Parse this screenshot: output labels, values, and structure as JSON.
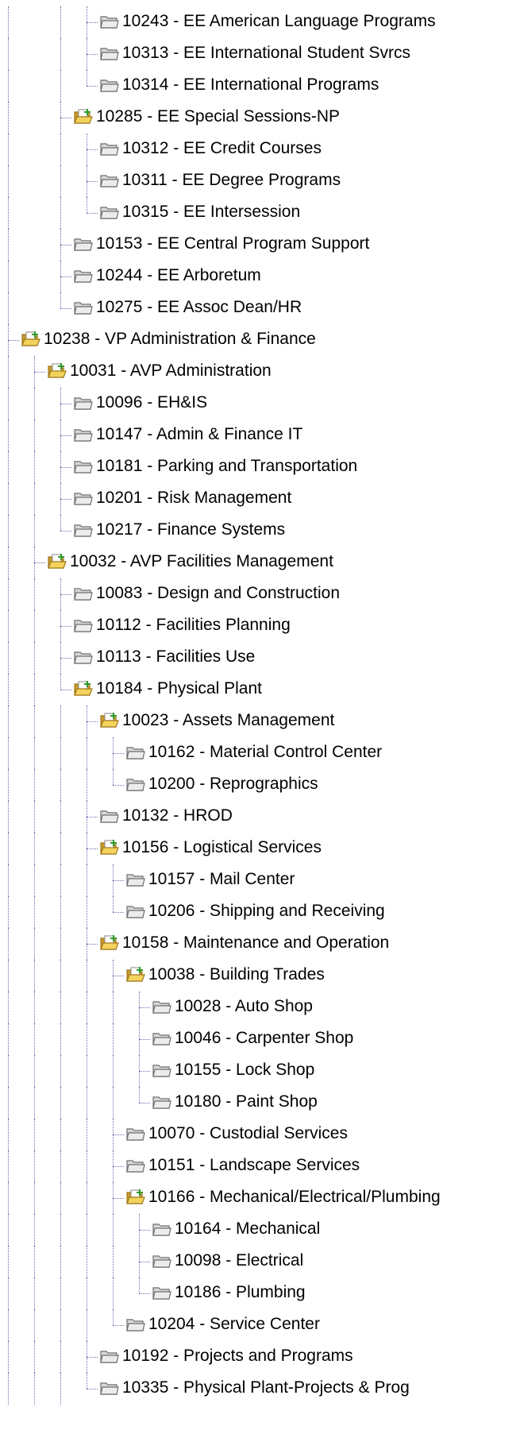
{
  "tree": [
    {
      "level": 3,
      "label": "10243 - EE American Language Programs",
      "icon": "folder-closed-icon",
      "last": false,
      "top_cont": true
    },
    {
      "level": 3,
      "label": "10313 - EE International Student Svrcs",
      "icon": "folder-closed-icon",
      "last": false
    },
    {
      "level": 3,
      "label": "10314 - EE International Programs",
      "icon": "folder-closed-icon",
      "last": true
    },
    {
      "level": 2,
      "label": "10285 - EE Special Sessions-NP",
      "icon": "folder-open-icon",
      "last": false
    },
    {
      "level": 3,
      "label": "10312 - EE Credit Courses",
      "icon": "folder-closed-icon",
      "last": false
    },
    {
      "level": 3,
      "label": "10311 - EE Degree Programs",
      "icon": "folder-closed-icon",
      "last": false
    },
    {
      "level": 3,
      "label": "10315 - EE Intersession",
      "icon": "folder-closed-icon",
      "last": true
    },
    {
      "level": 2,
      "label": "10153 - EE Central Program Support",
      "icon": "folder-closed-icon",
      "last": false
    },
    {
      "level": 2,
      "label": "10244 - EE Arboretum",
      "icon": "folder-closed-icon",
      "last": false
    },
    {
      "level": 2,
      "label": "10275 - EE Assoc Dean/HR",
      "icon": "folder-closed-icon",
      "last": true
    },
    {
      "level": 0,
      "label": "10238 - VP Administration & Finance",
      "icon": "folder-open-icon",
      "last": false
    },
    {
      "level": 1,
      "label": "10031 - AVP Administration",
      "icon": "folder-open-icon",
      "last": false
    },
    {
      "level": 2,
      "label": "10096 - EH&IS",
      "icon": "folder-closed-icon",
      "last": false
    },
    {
      "level": 2,
      "label": "10147 - Admin & Finance IT",
      "icon": "folder-closed-icon",
      "last": false
    },
    {
      "level": 2,
      "label": "10181 - Parking and Transportation",
      "icon": "folder-closed-icon",
      "last": false
    },
    {
      "level": 2,
      "label": "10201 - Risk Management",
      "icon": "folder-closed-icon",
      "last": false
    },
    {
      "level": 2,
      "label": "10217 - Finance Systems",
      "icon": "folder-closed-icon",
      "last": true
    },
    {
      "level": 1,
      "label": "10032 - AVP Facilities Management",
      "icon": "folder-open-icon",
      "last": false
    },
    {
      "level": 2,
      "label": "10083 - Design and Construction",
      "icon": "folder-closed-icon",
      "last": false
    },
    {
      "level": 2,
      "label": "10112 - Facilities Planning",
      "icon": "folder-closed-icon",
      "last": false
    },
    {
      "level": 2,
      "label": "10113 - Facilities Use",
      "icon": "folder-closed-icon",
      "last": false
    },
    {
      "level": 2,
      "label": "10184 - Physical Plant",
      "icon": "folder-open-icon",
      "last": true
    },
    {
      "level": 3,
      "label": "10023 - Assets Management",
      "icon": "folder-open-icon",
      "last": false
    },
    {
      "level": 4,
      "label": "10162 - Material Control Center",
      "icon": "folder-closed-icon",
      "last": false
    },
    {
      "level": 4,
      "label": "10200 - Reprographics",
      "icon": "folder-closed-icon",
      "last": true
    },
    {
      "level": 3,
      "label": "10132 - HROD",
      "icon": "folder-closed-icon",
      "last": false
    },
    {
      "level": 3,
      "label": "10156 - Logistical Services",
      "icon": "folder-open-icon",
      "last": false
    },
    {
      "level": 4,
      "label": "10157 - Mail Center",
      "icon": "folder-closed-icon",
      "last": false
    },
    {
      "level": 4,
      "label": "10206 - Shipping and Receiving",
      "icon": "folder-closed-icon",
      "last": true
    },
    {
      "level": 3,
      "label": "10158 - Maintenance and Operation",
      "icon": "folder-open-icon",
      "last": false
    },
    {
      "level": 4,
      "label": "10038 - Building Trades",
      "icon": "folder-open-icon",
      "last": false
    },
    {
      "level": 5,
      "label": "10028 - Auto Shop",
      "icon": "folder-closed-icon",
      "last": false
    },
    {
      "level": 5,
      "label": "10046 - Carpenter Shop",
      "icon": "folder-closed-icon",
      "last": false
    },
    {
      "level": 5,
      "label": "10155 - Lock Shop",
      "icon": "folder-closed-icon",
      "last": false
    },
    {
      "level": 5,
      "label": "10180 - Paint Shop",
      "icon": "folder-closed-icon",
      "last": true
    },
    {
      "level": 4,
      "label": "10070 - Custodial Services",
      "icon": "folder-closed-icon",
      "last": false
    },
    {
      "level": 4,
      "label": "10151 - Landscape Services",
      "icon": "folder-closed-icon",
      "last": false
    },
    {
      "level": 4,
      "label": "10166 - Mechanical/Electrical/Plumbing",
      "icon": "folder-open-icon",
      "last": false
    },
    {
      "level": 5,
      "label": "10164 - Mechanical",
      "icon": "folder-closed-icon",
      "last": false
    },
    {
      "level": 5,
      "label": "10098 - Electrical",
      "icon": "folder-closed-icon",
      "last": false
    },
    {
      "level": 5,
      "label": "10186 - Plumbing",
      "icon": "folder-closed-icon",
      "last": true
    },
    {
      "level": 4,
      "label": "10204 - Service Center",
      "icon": "folder-closed-icon",
      "last": true
    },
    {
      "level": 3,
      "label": "10192 - Projects and Programs",
      "icon": "folder-closed-icon",
      "last": false
    },
    {
      "level": 3,
      "label": "10335 - Physical Plant-Projects & Prog",
      "icon": "folder-closed-icon",
      "last": true
    }
  ],
  "colors": {
    "connector": "#6b6bb0",
    "folder_fill": "#d8d8d8",
    "folder_stroke": "#6e6e6e",
    "open_folder_fill": "#f3d35c",
    "open_folder_stroke": "#a0781e",
    "open_sheet": "#ffffff",
    "plus_green": "#2e9b2e"
  }
}
